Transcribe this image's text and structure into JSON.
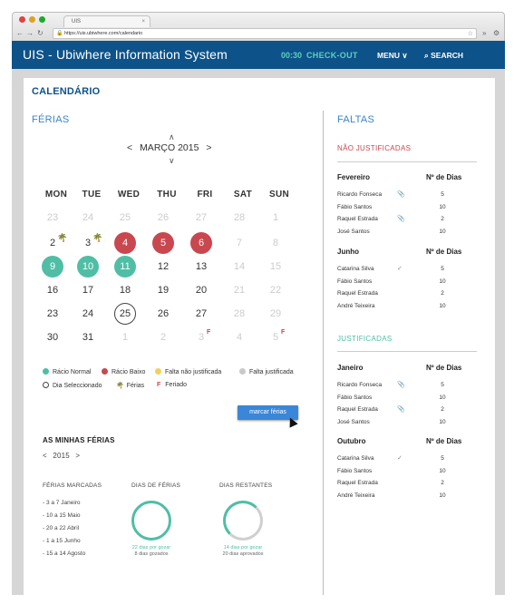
{
  "browser": {
    "tab_label": "UIS",
    "url": "https://uis.ubiwhere.com/calendario",
    "dots": [
      "#e0443e",
      "#dea123",
      "#1aab29"
    ]
  },
  "header": {
    "brand": "UIS - Ubiwhere Information System",
    "timer": "00:30",
    "checkout": "CHECK-OUT",
    "menu": "MENU ∨",
    "search": "SEARCH"
  },
  "page": {
    "title": "CALENDÁRIO"
  },
  "ferias": {
    "section_title": "FÉRIAS",
    "month_label": "MARÇO 2015",
    "weekdays": [
      "MON",
      "TUE",
      "WED",
      "THU",
      "FRI",
      "SAT",
      "SUN"
    ],
    "weeks": [
      [
        {
          "d": "23",
          "s": "m"
        },
        {
          "d": "24",
          "s": "m"
        },
        {
          "d": "25",
          "s": "m"
        },
        {
          "d": "26",
          "s": "m"
        },
        {
          "d": "27",
          "s": "m"
        },
        {
          "d": "28",
          "s": "m"
        },
        {
          "d": "1",
          "s": "m"
        }
      ],
      [
        {
          "d": "2",
          "s": "n",
          "palm": true
        },
        {
          "d": "3",
          "s": "n",
          "palm": true
        },
        {
          "d": "4",
          "s": "r"
        },
        {
          "d": "5",
          "s": "r"
        },
        {
          "d": "6",
          "s": "r"
        },
        {
          "d": "7",
          "s": "m"
        },
        {
          "d": "8",
          "s": "m"
        }
      ],
      [
        {
          "d": "9",
          "s": "g"
        },
        {
          "d": "10",
          "s": "g"
        },
        {
          "d": "11",
          "s": "g"
        },
        {
          "d": "12",
          "s": "n"
        },
        {
          "d": "13",
          "s": "n"
        },
        {
          "d": "14",
          "s": "m"
        },
        {
          "d": "15",
          "s": "m"
        }
      ],
      [
        {
          "d": "16",
          "s": "n"
        },
        {
          "d": "17",
          "s": "n"
        },
        {
          "d": "18",
          "s": "n"
        },
        {
          "d": "19",
          "s": "n"
        },
        {
          "d": "20",
          "s": "n"
        },
        {
          "d": "21",
          "s": "m"
        },
        {
          "d": "22",
          "s": "m"
        }
      ],
      [
        {
          "d": "23",
          "s": "n"
        },
        {
          "d": "24",
          "s": "n"
        },
        {
          "d": "25",
          "s": "sel"
        },
        {
          "d": "26",
          "s": "n"
        },
        {
          "d": "27",
          "s": "n"
        },
        {
          "d": "28",
          "s": "m"
        },
        {
          "d": "29",
          "s": "m"
        }
      ],
      [
        {
          "d": "30",
          "s": "n"
        },
        {
          "d": "31",
          "s": "n"
        },
        {
          "d": "1",
          "s": "m"
        },
        {
          "d": "2",
          "s": "m"
        },
        {
          "d": "3",
          "s": "m",
          "feriado": true
        },
        {
          "d": "4",
          "s": "m"
        },
        {
          "d": "5",
          "s": "m",
          "feriado": true
        }
      ]
    ],
    "legend": {
      "normal": "Rácio Normal",
      "baixo": "Rácio Baixo",
      "falta_nj": "Falta não justificada",
      "falta_j": "Falta justificada",
      "dia_sel": "Dia Seleccionado",
      "ferias": "Férias",
      "feriado": "Feriado",
      "feriado_mark": "F"
    },
    "colors": {
      "green": "#4fbea5",
      "red": "#c9474e",
      "yellow": "#f3d05c",
      "grey": "#c9c9c9"
    },
    "button": "marcar férias"
  },
  "minhas": {
    "title": "AS MINHAS FÉRIAS",
    "year": "2015",
    "col1_title": "FÉRIAS MARCADAS",
    "col2_title": "DIAS DE FÉRIAS",
    "col3_title": "DIAS RESTANTES",
    "periods": [
      "- 3 a 7 Janeiro",
      "- 10 a 15 Maio",
      "- 20 a 22 Abril",
      "- 1 a 15 Junho",
      "- 15 a 14 Agosto"
    ],
    "dias_ferias_a": "22 dias por gozar",
    "dias_ferias_b": "8 dias gozados",
    "dias_rest_a": "14 dias por gozar",
    "dias_rest_b": "20 dias aprovados"
  },
  "faltas": {
    "section_title": "FALTAS",
    "nao_justificadas": "NÃO JUSTIFICADAS",
    "justificadas": "JUSTIFICADAS",
    "num_dias": "Nº de Dias",
    "nj_fev": {
      "month": "Fevereiro",
      "rows": [
        {
          "name": "Ricardo Fonseca",
          "n": "5",
          "clip": true
        },
        {
          "name": "Fábio Santos",
          "n": "10"
        },
        {
          "name": "Raquel Estrada",
          "n": "2",
          "clip": true
        },
        {
          "name": "José Santos",
          "n": "10"
        }
      ]
    },
    "nj_jun": {
      "month": "Junho",
      "rows": [
        {
          "name": "Catarina Silva",
          "n": "5",
          "check": true
        },
        {
          "name": "Fábio Santos",
          "n": "10"
        },
        {
          "name": "Raquel Estrada",
          "n": "2"
        },
        {
          "name": "André Teixeira",
          "n": "10"
        }
      ]
    },
    "j_jan": {
      "month": "Janeiro",
      "rows": [
        {
          "name": "Ricardo Fonseca",
          "n": "5",
          "clip": true
        },
        {
          "name": "Fábio Santos",
          "n": "10"
        },
        {
          "name": "Raquel Estrada",
          "n": "2",
          "clip": true
        },
        {
          "name": "José Santos",
          "n": "10"
        }
      ]
    },
    "j_out": {
      "month": "Outubro",
      "rows": [
        {
          "name": "Catarina Silva",
          "n": "5",
          "check": true
        },
        {
          "name": "Fábio Santos",
          "n": "10"
        },
        {
          "name": "Raquel Estrada",
          "n": "2"
        },
        {
          "name": "André Teixeira",
          "n": "10"
        }
      ]
    }
  }
}
